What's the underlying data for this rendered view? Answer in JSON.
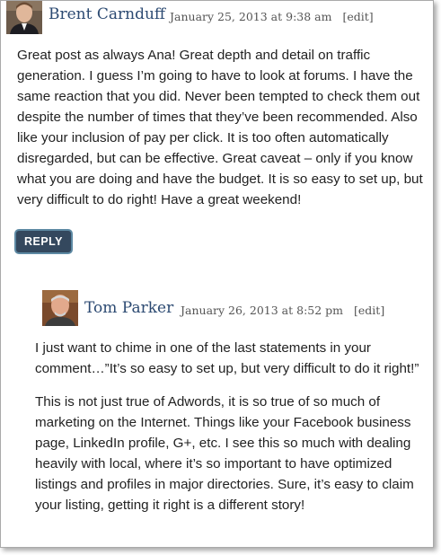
{
  "comments": [
    {
      "author": "Brent Carnduff",
      "date": "January 25, 2013 at 9:38 am",
      "edit_label": "[edit]",
      "avatar_icon": "person-photo-avatar",
      "paragraphs": [
        "Great post as always Ana! Great depth and detail on traffic generation. I guess I’m going to have to look at forums. I have the same reaction that you did. Never been tempted to check them out despite the number of times that they’ve been recommended. Also like your inclusion of pay per click. It is too often automatically disregarded, but can be effective. Great caveat – only if you know what you are doing and have the budget. It is so easy to set up, but very difficult to do right! Have a great weekend!"
      ],
      "reply_label": "REPLY"
    },
    {
      "author": "Tom Parker",
      "date": "January 26, 2013 at 8:52 pm",
      "edit_label": "[edit]",
      "avatar_icon": "person-photo-avatar",
      "paragraphs": [
        "I just want to chime in one of the last statements in your comment…”It’s so easy to set up, but very difficult to do it right!”",
        "This is not just true of Adwords, it is so true of so much of marketing on the Internet. Things like your Facebook business page, LinkedIn profile, G+, etc. I see this so much with dealing heavily with local, where it’s so important to have optimized listings and profiles in major directories. Sure, it’s easy to claim your listing, getting it right is a different story!"
      ]
    }
  ],
  "colors": {
    "author_link": "#2c4a72",
    "reply_button_bg": "#34485e",
    "reply_button_border": "#5d89a3"
  }
}
